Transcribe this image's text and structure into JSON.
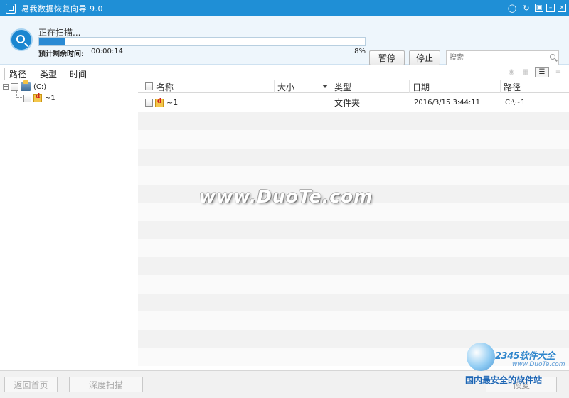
{
  "window": {
    "title": "易我数据恢复向导 9.0",
    "controls": [
      "chat",
      "refresh",
      "restore",
      "minimize",
      "close"
    ]
  },
  "scan": {
    "status": "正在扫描...",
    "progress_percent": 8,
    "progress_label": "8%",
    "remaining_label": "预计剩余时间:",
    "remaining_value": "00:00:14",
    "pause_label": "暂停",
    "stop_label": "停止",
    "search_placeholder": "搜索"
  },
  "tabs": [
    {
      "label": "路径",
      "active": true
    },
    {
      "label": "类型",
      "active": false
    },
    {
      "label": "时间",
      "active": false
    }
  ],
  "tree": {
    "root": {
      "label": "(C:)",
      "expanded": true
    },
    "children": [
      {
        "label": "~1"
      }
    ]
  },
  "table": {
    "columns": [
      "名称",
      "大小",
      "类型",
      "日期",
      "路径"
    ],
    "rows": [
      {
        "name": "~1",
        "size": "",
        "type": "文件夹",
        "date": "2016/3/15 3:44:11",
        "path": "C:\\~1"
      }
    ]
  },
  "watermark": "www.DuoTe.com",
  "bottom": {
    "home_label": "返回首页",
    "deep_scan_label": "深度扫描",
    "recover_label": "恢复"
  },
  "corner_logo": {
    "brand": "2345软件大全",
    "url": "www.DuoTe.com",
    "slogan": "国内最安全的软件站"
  },
  "colors": {
    "titlebar": "#1f8fd6",
    "accent": "#2a8ad4",
    "header_bg": "#eef6fc"
  }
}
